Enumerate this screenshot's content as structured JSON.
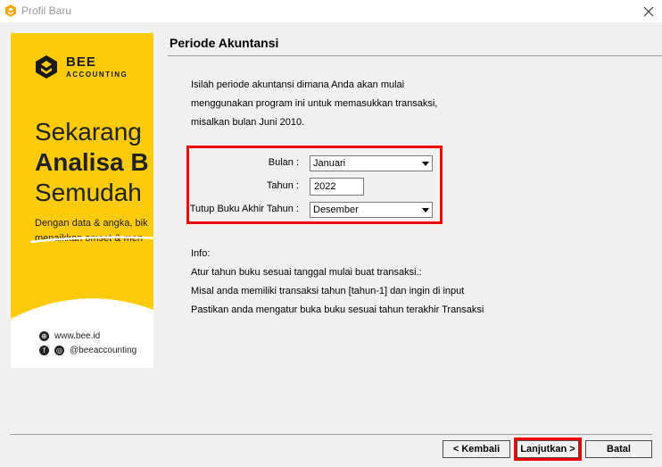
{
  "window": {
    "title": "Profil Baru"
  },
  "banner": {
    "brand": "BEE",
    "brand_sub": "ACCOUNTING",
    "headline_1": "Sekarang",
    "headline_2": "Analisa B",
    "headline_3": "Semudah",
    "sub_1": "Dengan data & angka, bik",
    "sub_2": "menaikkan omset & men",
    "website": "www.bee.id",
    "social": "@beeaccounting"
  },
  "page": {
    "title": "Periode Akuntansi",
    "desc_1": "Isilah periode akuntansi dimana Anda akan mulai",
    "desc_2": "menggunakan program ini untuk memasukkan transaksi,",
    "desc_3": "misalkan bulan Juni 2010."
  },
  "form": {
    "bulan_label": "Bulan :",
    "bulan_value": "Januari",
    "tahun_label": "Tahun :",
    "tahun_value": "2022",
    "tutup_label": "Tutup Buku Akhir Tahun :",
    "tutup_value": "Desember"
  },
  "info": {
    "heading": "Info:",
    "line_1": "Atur tahun buku sesuai tanggal mulai buat transaksi.:",
    "line_2": "Misal anda memiliki transaksi tahun [tahun-1] dan ingin di input",
    "line_3": "Pastikan anda mengatur buka buku sesuai tahun terakhir Transaksi"
  },
  "buttons": {
    "back": "< Kembali",
    "next": "Lanjutkan >",
    "cancel": "Batal"
  },
  "colors": {
    "banner": "#fecb0a",
    "highlight": "#ee0000"
  }
}
